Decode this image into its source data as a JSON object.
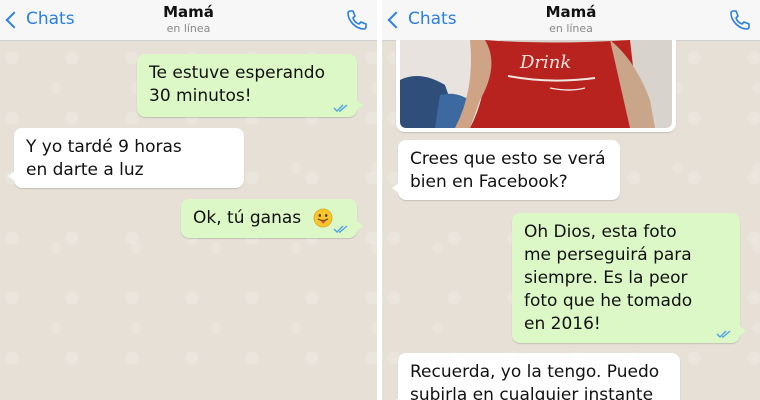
{
  "left": {
    "header": {
      "back_label": "Chats",
      "title": "Mamá",
      "status": "en línea"
    },
    "messages": [
      {
        "type": "out",
        "lines": [
          "Te estuve esperando",
          "30 minutos!"
        ]
      },
      {
        "type": "in",
        "lines": [
          "Y yo tardé 9 horas",
          "en darte a luz"
        ]
      },
      {
        "type": "out",
        "text": "Ok, tú ganas",
        "emoji": "tongue-face-icon"
      }
    ]
  },
  "right": {
    "header": {
      "back_label": "Chats",
      "title": "Mamá",
      "status": "en línea"
    },
    "photo": {
      "shirt_text": "Drink"
    },
    "messages": [
      {
        "type": "in",
        "lines": [
          "Crees que esto se verá",
          "bien en Facebook?"
        ]
      },
      {
        "type": "out",
        "lines": [
          "Oh Dios, esta foto",
          "me perseguirá para",
          "siempre. Es la peor",
          "foto que he tomado",
          "en 2016!"
        ]
      },
      {
        "type": "in",
        "lines": [
          "Recuerda, yo la tengo. Puedo",
          "subirla en cualquier instante"
        ]
      }
    ]
  },
  "colors": {
    "accent": "#2a7fe0",
    "outgoing": "#dcf8c6",
    "incoming": "#ffffff",
    "wallpaper": "#e6e0d6",
    "read_ticks": "#4fa3e0"
  }
}
